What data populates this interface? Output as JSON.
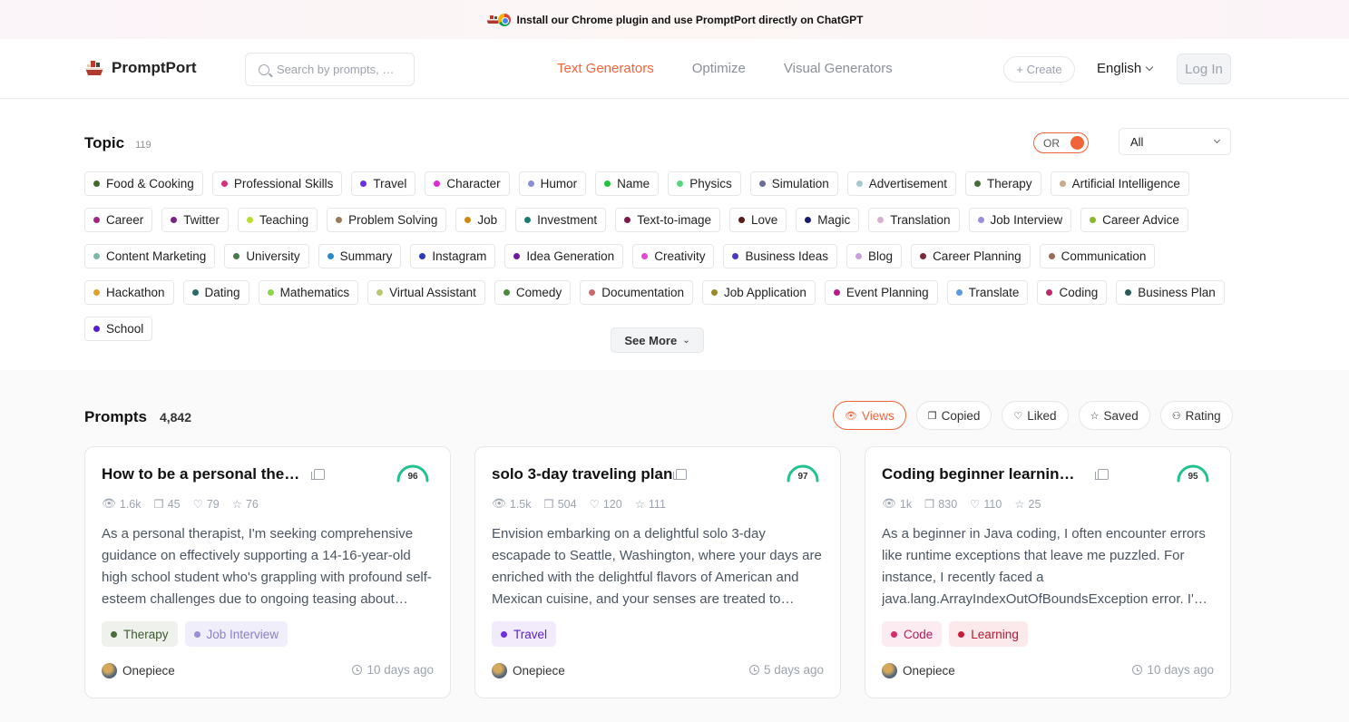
{
  "banner": {
    "text": "Install our Chrome plugin and use PromptPort directly on ChatGPT",
    "icons": [
      "ship-icon",
      "chrome-icon"
    ]
  },
  "header": {
    "logo": "PromptPort",
    "search_placeholder": "Search by prompts, …",
    "nav": [
      "Text Generators",
      "Optimize",
      "Visual Generators"
    ],
    "nav_active": "Text Generators",
    "create_label": "+ Create",
    "language": "English",
    "login_label": "Log In"
  },
  "topic": {
    "title": "Topic",
    "count": "119",
    "toggle_label": "OR",
    "filter_value": "All",
    "see_more": "See More",
    "tags": [
      {
        "label": "Food & Cooking",
        "color": "#3f6b2e"
      },
      {
        "label": "Professional Skills",
        "color": "#d6337a"
      },
      {
        "label": "Travel",
        "color": "#6b2ee0"
      },
      {
        "label": "Character",
        "color": "#d92ad6"
      },
      {
        "label": "Humor",
        "color": "#8a8fd6"
      },
      {
        "label": "Name",
        "color": "#22c33c"
      },
      {
        "label": "Physics",
        "color": "#56d67e"
      },
      {
        "label": "Simulation",
        "color": "#6d6d9c"
      },
      {
        "label": "Advertisement",
        "color": "#a8c8cf"
      },
      {
        "label": "Therapy",
        "color": "#4a6b3a"
      },
      {
        "label": "Artificial Intelligence",
        "color": "#c9a98b"
      },
      {
        "label": "Career",
        "color": "#a0267f"
      },
      {
        "label": "Twitter",
        "color": "#7a2386"
      },
      {
        "label": "Teaching",
        "color": "#b9e02e"
      },
      {
        "label": "Problem Solving",
        "color": "#9a7a5a"
      },
      {
        "label": "Job",
        "color": "#c98a14"
      },
      {
        "label": "Investment",
        "color": "#1f7a6e"
      },
      {
        "label": "Text-to-image",
        "color": "#7a1a4a"
      },
      {
        "label": "Love",
        "color": "#5a1a1a"
      },
      {
        "label": "Magic",
        "color": "#1a1a6e"
      },
      {
        "label": "Translation",
        "color": "#d9b0cf"
      },
      {
        "label": "Job Interview",
        "color": "#9a8fd6"
      },
      {
        "label": "Career Advice",
        "color": "#8ab82a"
      },
      {
        "label": "Content Marketing",
        "color": "#7ab8a8"
      },
      {
        "label": "University",
        "color": "#4a7a4a"
      },
      {
        "label": "Summary",
        "color": "#2a8ac8"
      },
      {
        "label": "Instagram",
        "color": "#2a3ab8"
      },
      {
        "label": "Idea Generation",
        "color": "#6a1a9a"
      },
      {
        "label": "Creativity",
        "color": "#e04ad0"
      },
      {
        "label": "Business Ideas",
        "color": "#4a3ab8"
      },
      {
        "label": "Blog",
        "color": "#c8a0e0"
      },
      {
        "label": "Career Planning",
        "color": "#7a2a3a"
      },
      {
        "label": "Communication",
        "color": "#9a6a5a"
      },
      {
        "label": "Hackathon",
        "color": "#e0a02a"
      },
      {
        "label": "Dating",
        "color": "#2a6a6a"
      },
      {
        "label": "Mathematics",
        "color": "#8ad64a"
      },
      {
        "label": "Virtual Assistant",
        "color": "#b8c86a"
      },
      {
        "label": "Comedy",
        "color": "#4a8a3a"
      },
      {
        "label": "Documentation",
        "color": "#c86a6a"
      },
      {
        "label": "Job Application",
        "color": "#9a8a2a"
      },
      {
        "label": "Event Planning",
        "color": "#b81a8a"
      },
      {
        "label": "Translate",
        "color": "#5a9ae0"
      },
      {
        "label": "Coding",
        "color": "#b82a6a"
      },
      {
        "label": "Business Plan",
        "color": "#2a5a5a"
      },
      {
        "label": "School",
        "color": "#5a1ad0"
      }
    ]
  },
  "prompts": {
    "title": "Prompts",
    "count": "4,842",
    "sorts": [
      {
        "label": "Views",
        "icon": "eye-icon",
        "active": true
      },
      {
        "label": "Copied",
        "icon": "copy-icon",
        "active": false
      },
      {
        "label": "Liked",
        "icon": "heart-icon",
        "active": false
      },
      {
        "label": "Saved",
        "icon": "star-icon",
        "active": false
      },
      {
        "label": "Rating",
        "icon": "rating-icon",
        "active": false
      }
    ],
    "cards": [
      {
        "title": "How to be a personal thera…",
        "score": 96,
        "views": "1.6k",
        "copies": "45",
        "likes": "79",
        "saves": "76",
        "description": "As a personal therapist, I'm seeking comprehensive guidance on effectively supporting a 14-16-year-old high school student who's grappling with profound self-esteem challenges due to ongoing teasing about…",
        "tags": [
          {
            "label": "Therapy",
            "dot": "#4a6b3a",
            "bg": "#eef1ec",
            "fg": "#3d5a30"
          },
          {
            "label": "Job Interview",
            "dot": "#9a8fd6",
            "bg": "#f0eefa",
            "fg": "#8a80c8"
          }
        ],
        "author": "Onepiece",
        "time": "10 days ago"
      },
      {
        "title": "solo 3-day traveling plan",
        "score": 97,
        "views": "1.5k",
        "copies": "504",
        "likes": "120",
        "saves": "111",
        "description": "Envision embarking on a delightful solo 3-day escapade to Seattle, Washington, where your days are enriched with the delightful flavors of American and Mexican cuisine, and your senses are treated to…",
        "tags": [
          {
            "label": "Travel",
            "dot": "#6b2ee0",
            "bg": "#f1ebfc",
            "fg": "#5a22c8"
          }
        ],
        "author": "Onepiece",
        "time": "5 days ago"
      },
      {
        "title": "Coding beginner learning (…",
        "score": 95,
        "views": "1k",
        "copies": "830",
        "likes": "110",
        "saves": "25",
        "description": "As a beginner in Java coding, I often encounter errors like runtime exceptions that leave me puzzled. For instance, I recently faced a java.lang.ArrayIndexOutOfBoundsException error. I'…",
        "tags": [
          {
            "label": "Code",
            "dot": "#d62a6a",
            "bg": "#fcebf1",
            "fg": "#b81a5a"
          },
          {
            "label": "Learning",
            "dot": "#c81a3a",
            "bg": "#fbe9ec",
            "fg": "#b01a32"
          }
        ],
        "author": "Onepiece",
        "time": "10 days ago"
      }
    ]
  }
}
